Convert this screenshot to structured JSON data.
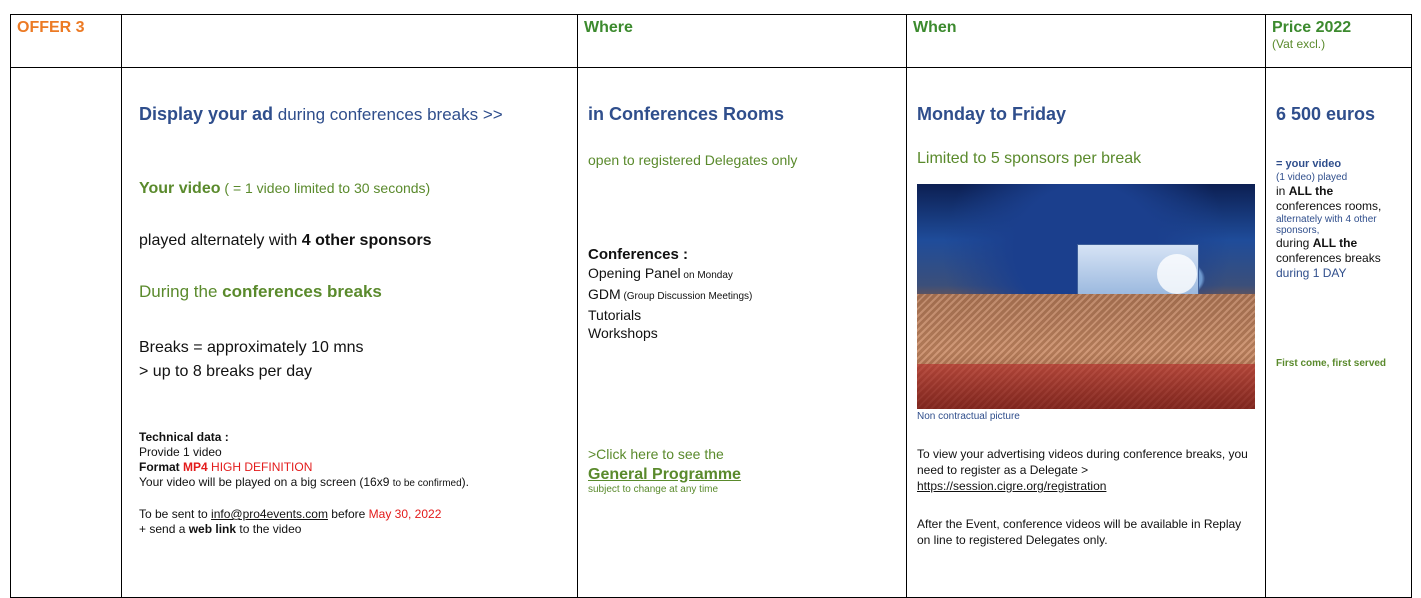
{
  "header": {
    "offer": "OFFER 3",
    "where": "Where",
    "when": "When",
    "price": "Price 2022",
    "vat": "(Vat excl.)"
  },
  "col1": {
    "display_bold": "Display your ad",
    "display_rest": " during conferences breaks  >>",
    "video_bold": "Your video",
    "video_rest": " ( = 1 video limited to 30 seconds)",
    "played_pre": "played alternately with ",
    "played_bold": "4 other sponsors",
    "during_pre": "During the ",
    "during_bold": "conferences breaks",
    "breaks1": "Breaks = approximately 10 mns",
    "breaks2": "> up to 8 breaks per day",
    "tech_title": "Technical data :",
    "tech_provide": "Provide 1 video",
    "tech_format": "Format ",
    "tech_mp4": "MP4",
    "tech_hd": " HIGH DEFINITION",
    "tech_screen_a": "Your video will be played on a big screen (16x9 ",
    "tech_screen_b": "to be confirmed",
    "tech_screen_c": ").",
    "send_pre": "To be sent to ",
    "send_email": "info@pro4events.com",
    "send_mid": " before ",
    "send_date": "May 30, 2022",
    "send2_pre": "+ send a ",
    "send2_bold": "web link",
    "send2_post": " to the video"
  },
  "col2": {
    "title": "in Conferences Rooms",
    "open": "open to registered Delegates only",
    "conf_title": "Conferences :",
    "opening": "Opening Panel",
    "opening_small": " on Monday",
    "gdm": "GDM",
    "gdm_small": " (Group Discussion Meetings)",
    "tutorials": "Tutorials",
    "workshops": "Workshops",
    "click": ">Click here to see the",
    "programme": "General Programme",
    "subject": "subject to change at any time"
  },
  "col3": {
    "title": "Monday to Friday",
    "limited": "Limited to 5 sponsors per break",
    "caption": "Non contractual picture",
    "view": "To view your advertising videos during conference breaks, you need to register as a Delegate >",
    "url": "https://session.cigre.org/registration",
    "after": "After the Event, conference videos will be available in Replay on line to registered Delegates only."
  },
  "col4": {
    "price": "6 500 euros",
    "eq": "= your video",
    "one": "(1 video) played",
    "in_pre": "in ",
    "in_bold": "ALL the",
    "rooms": "conferences rooms,",
    "alt": "alternately with 4 other sponsors,",
    "during_pre": "during ",
    "during_bold": "ALL the",
    "breaks": "conferences breaks",
    "day": "during 1 DAY",
    "first": "First come, first served"
  },
  "colors": {
    "orange": "#ec7a24",
    "green": "#5a8a2c",
    "blue": "#2f4e8c",
    "red": "#e31b1b"
  }
}
